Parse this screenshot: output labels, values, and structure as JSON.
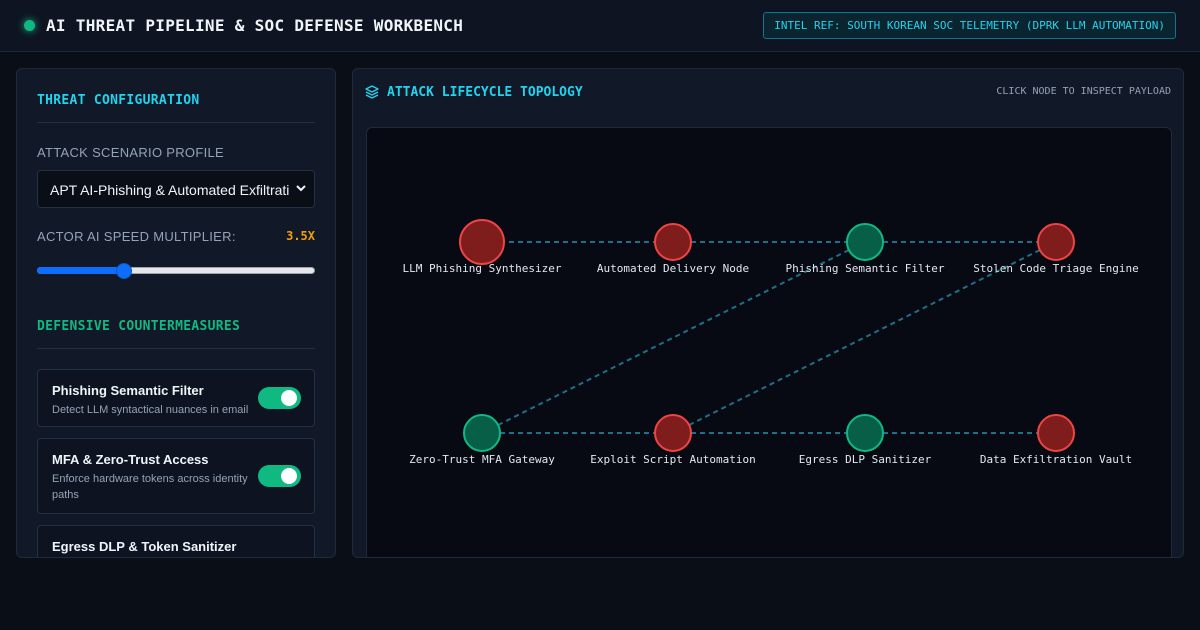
{
  "header": {
    "title": "AI THREAT PIPELINE & SOC DEFENSE WORKBENCH",
    "intel_ref": "INTEL REF: SOUTH KOREAN SOC TELEMETRY (DPRK LLM AUTOMATION)"
  },
  "config": {
    "title": "THREAT CONFIGURATION",
    "scenario_label": "ATTACK SCENARIO PROFILE",
    "scenario_value": "APT AI-Phishing & Automated Exfiltration",
    "speed_label": "ACTOR AI SPEED MULTIPLIER:",
    "speed_value": "3.5X",
    "speed_fraction": 0.3
  },
  "defense": {
    "title": "DEFENSIVE COUNTERMEASURES",
    "cards": [
      {
        "title": "Phishing Semantic Filter",
        "desc": "Detect LLM syntactical nuances in email",
        "enabled": true
      },
      {
        "title": "MFA & Zero-Trust Access",
        "desc": "Enforce hardware tokens across identity paths",
        "enabled": true
      },
      {
        "title": "Egress DLP & Token Sanitizer",
        "desc": "",
        "enabled": true
      }
    ]
  },
  "topology": {
    "title": "ATTACK LIFECYCLE TOPOLOGY",
    "hint": "CLICK NODE TO INSPECT PAYLOAD",
    "nodes": [
      {
        "label": "LLM Phishing Synthesizer",
        "state": "threat",
        "size": "large"
      },
      {
        "label": "Automated Delivery Node",
        "state": "threat",
        "size": "normal"
      },
      {
        "label": "Phishing Semantic Filter",
        "state": "defense",
        "size": "normal"
      },
      {
        "label": "Stolen Code Triage Engine",
        "state": "threat",
        "size": "normal"
      },
      {
        "label": "Zero-Trust MFA Gateway",
        "state": "defense",
        "size": "normal"
      },
      {
        "label": "Exploit Script Automation",
        "state": "threat",
        "size": "normal"
      },
      {
        "label": "Egress DLP Sanitizer",
        "state": "defense",
        "size": "normal"
      },
      {
        "label": "Data Exfiltration Vault",
        "state": "threat",
        "size": "normal"
      }
    ],
    "links": [
      [
        0,
        1
      ],
      [
        1,
        2
      ],
      [
        2,
        3
      ],
      [
        4,
        5
      ],
      [
        5,
        6
      ],
      [
        6,
        7
      ],
      [
        4,
        2
      ],
      [
        5,
        3
      ]
    ],
    "colors": {
      "threat_fill": "#7f1d1d",
      "threat_stroke": "#ef4444",
      "defense_fill": "#065f46",
      "defense_stroke": "#10b981",
      "link": "#1f6f8b"
    }
  }
}
